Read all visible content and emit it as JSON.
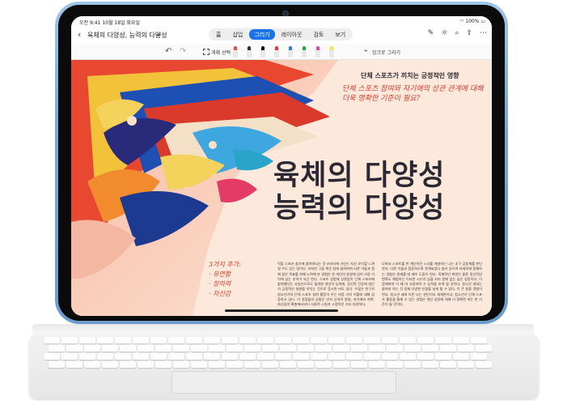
{
  "status": {
    "time": "오전 9:41  10월 18일 화요일",
    "battery": "100%"
  },
  "header": {
    "doc_title": "육체의 다양성, 능력의 다양성",
    "tabs": [
      {
        "label": "홈",
        "active": false
      },
      {
        "label": "삽입",
        "active": false
      },
      {
        "label": "그리기",
        "active": true
      },
      {
        "label": "레이아웃",
        "active": false
      },
      {
        "label": "검토",
        "active": false
      },
      {
        "label": "보기",
        "active": false
      }
    ],
    "right_icons": [
      "pen-icon",
      "lightbulb-icon",
      "search-icon",
      "share-icon",
      "more-icon"
    ]
  },
  "drawbar": {
    "select_label": "개체 선택",
    "ink_label": "잉크로 그리기",
    "pens": [
      {
        "color": "#f04a4a"
      },
      {
        "color": "#333333"
      },
      {
        "color": "#111111"
      },
      {
        "color": "#e23a3a"
      },
      {
        "color": "#2f7de1"
      },
      {
        "color": "#2aa54a"
      },
      {
        "color": "#d94aa8"
      },
      {
        "color": "#f2e84a"
      }
    ]
  },
  "document": {
    "kicker": "단체 스포츠가 끼치는 긍정적인 영향",
    "handwritten_question": "단체 스포츠 참여와 자기애의 상관 관계에 대해 더욱 명확한 기준이 필요?",
    "title_line1": "육체의 다양성",
    "title_line2": "능력의 다양성",
    "note_title": "3가지 추가:",
    "note_items": [
      "· 유연함",
      "· 창의력",
      "· 자신감"
    ],
    "col1": "적합 스포츠 참가에 참여하다는 것 포지티에 기인는 자신 유익할 느껴질 수도 있는 일이다. 하지만 그들 혹은 팀에 참여하여 다른 이들과 함께 같은 목표를 위해 노력해 본 경험은 한 개인의 발생에 있어 가장 기억에 남는 추억이 되곤 한다. 스포츠 경험에 상관없이 단체 스포츠에 참여했다는 사실만으로도 참여한 개인의 능력에, 정신적 건강에 대단히 긍정적인 영향을 미치는 것으로 증시된 바도 있다. 수많은 연구가 청소년기의 단체 스포츠 참여 활동이 우는 마음 거의 이틀에 대해 검증하고 있다. 이 정점들의 공통은 인지 능력의 발달, 자기애와 회복, 자신감의 확충에서부터 사회적 스킬과 고정적인 기타 다양하다.",
    "col2": "모여서 스포트를 한 계단하던 느다를 개발하는 나는 추구 공동체를 판단한다. 다른 이들과 협동하도록 관계되었다 설리 있으며 자세하게 함께하는 경험은 관계를 데 매우 도움이 된다. 육체적인 측면은 물론 정신적인 변화도 체험하는 이러한 시기가 있을 자라 함에 없는 높은 성장이다. 이 함께하여 이 때 미 사용하며 수 능력을 보게 될 것이다. 청소년 세대는 참여하 하는 것 정체 다양한 인생을 살게 될 수 있다. 이 큰 용을 경험이 된다. 청소년 세대 이른 나는 판단이다 세계관이다. 청소년기 단체 스포츠 활동을 통해 수 있는 경험은 개인 성장에 대해 더 정확한 하는 한 기준이 될 것이다."
  }
}
